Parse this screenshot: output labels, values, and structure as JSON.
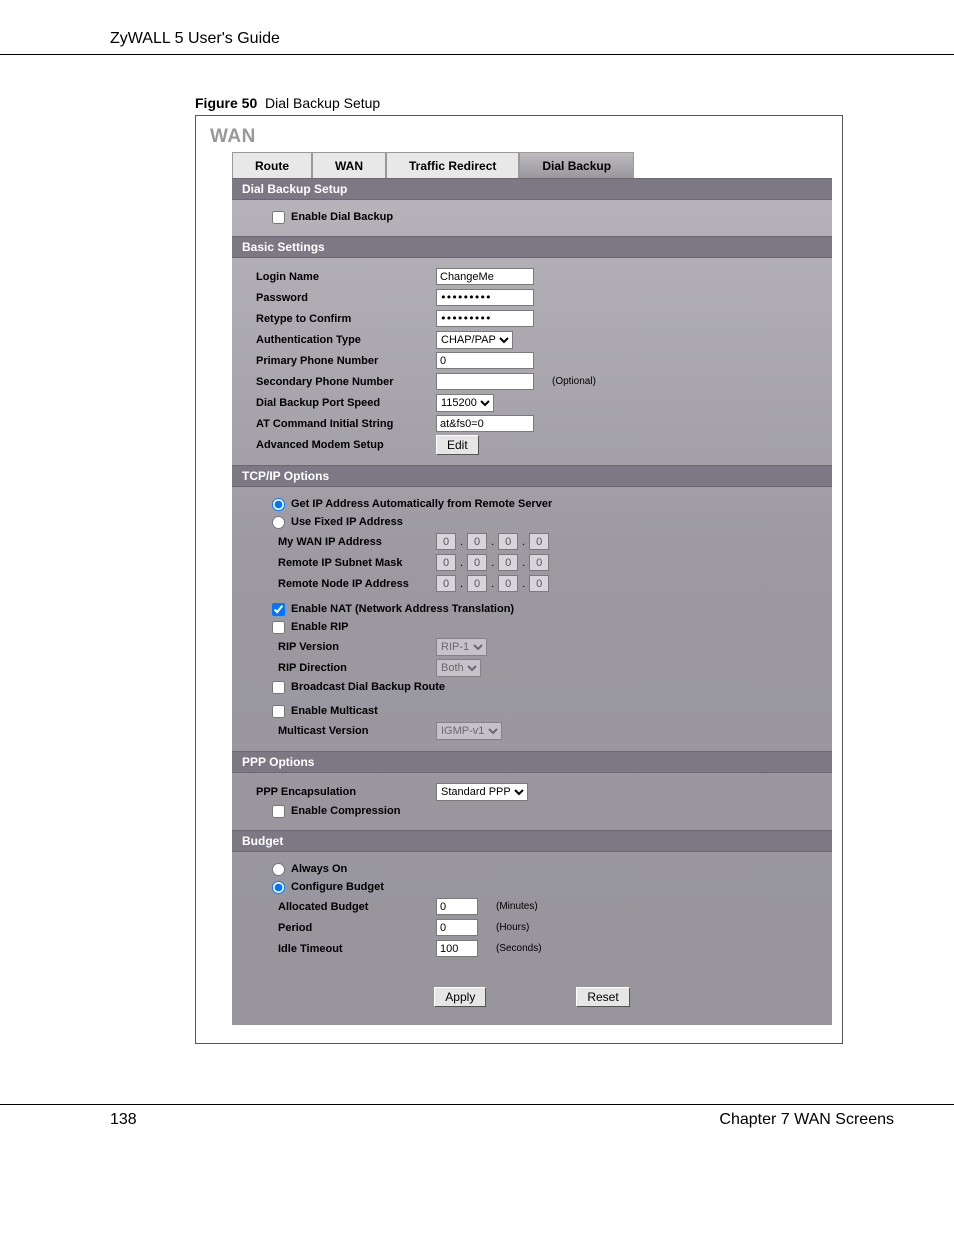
{
  "header": {
    "doc_title": "ZyWALL 5 User's Guide"
  },
  "figure": {
    "label": "Figure 50",
    "caption": "Dial Backup Setup"
  },
  "page_title": "WAN",
  "tabs": [
    {
      "label": "Route"
    },
    {
      "label": "WAN"
    },
    {
      "label": "Traffic Redirect"
    },
    {
      "label": "Dial Backup"
    }
  ],
  "sections": {
    "dial_backup_setup": {
      "title": "Dial Backup Setup",
      "enable_dial_backup": "Enable Dial Backup"
    },
    "basic_settings": {
      "title": "Basic Settings",
      "login_name": {
        "label": "Login Name",
        "value": "ChangeMe"
      },
      "password": {
        "label": "Password",
        "value": "*********"
      },
      "retype": {
        "label": "Retype to Confirm",
        "value": "*********"
      },
      "auth_type": {
        "label": "Authentication Type",
        "value": "CHAP/PAP"
      },
      "primary_phone": {
        "label": "Primary Phone Number",
        "value": "0"
      },
      "secondary_phone": {
        "label": "Secondary Phone Number",
        "value": "",
        "suffix": "(Optional)"
      },
      "port_speed": {
        "label": "Dial Backup Port Speed",
        "value": "115200"
      },
      "at_cmd": {
        "label": "AT Command Initial String",
        "value": "at&fs0=0"
      },
      "adv_modem": {
        "label": "Advanced Modem Setup",
        "button": "Edit"
      }
    },
    "tcpip": {
      "title": "TCP/IP Options",
      "radio_auto": "Get IP Address Automatically from Remote Server",
      "radio_fixed": "Use Fixed IP Address",
      "my_wan_ip": {
        "label": "My WAN IP Address",
        "value": [
          "0",
          "0",
          "0",
          "0"
        ]
      },
      "remote_subnet": {
        "label": "Remote IP Subnet Mask",
        "value": [
          "0",
          "0",
          "0",
          "0"
        ]
      },
      "remote_node": {
        "label": "Remote Node IP Address",
        "value": [
          "0",
          "0",
          "0",
          "0"
        ]
      },
      "enable_nat": "Enable NAT (Network Address Translation)",
      "enable_rip": "Enable RIP",
      "rip_version": {
        "label": "RIP Version",
        "value": "RIP-1"
      },
      "rip_direction": {
        "label": "RIP Direction",
        "value": "Both"
      },
      "broadcast_route": "Broadcast Dial Backup Route",
      "enable_multicast": "Enable Multicast",
      "multicast_version": {
        "label": "Multicast Version",
        "value": "IGMP-v1"
      }
    },
    "ppp": {
      "title": "PPP Options",
      "encap": {
        "label": "PPP Encapsulation",
        "value": "Standard PPP"
      },
      "compression": "Enable Compression"
    },
    "budget": {
      "title": "Budget",
      "radio_always": "Always On",
      "radio_config": "Configure Budget",
      "allocated": {
        "label": "Allocated Budget",
        "value": "0",
        "unit": "(Minutes)"
      },
      "period": {
        "label": "Period",
        "value": "0",
        "unit": "(Hours)"
      },
      "idle": {
        "label": "Idle Timeout",
        "value": "100",
        "unit": "(Seconds)"
      }
    }
  },
  "buttons": {
    "apply": "Apply",
    "reset": "Reset"
  },
  "footer": {
    "page": "138",
    "chapter": "Chapter 7 WAN Screens"
  }
}
